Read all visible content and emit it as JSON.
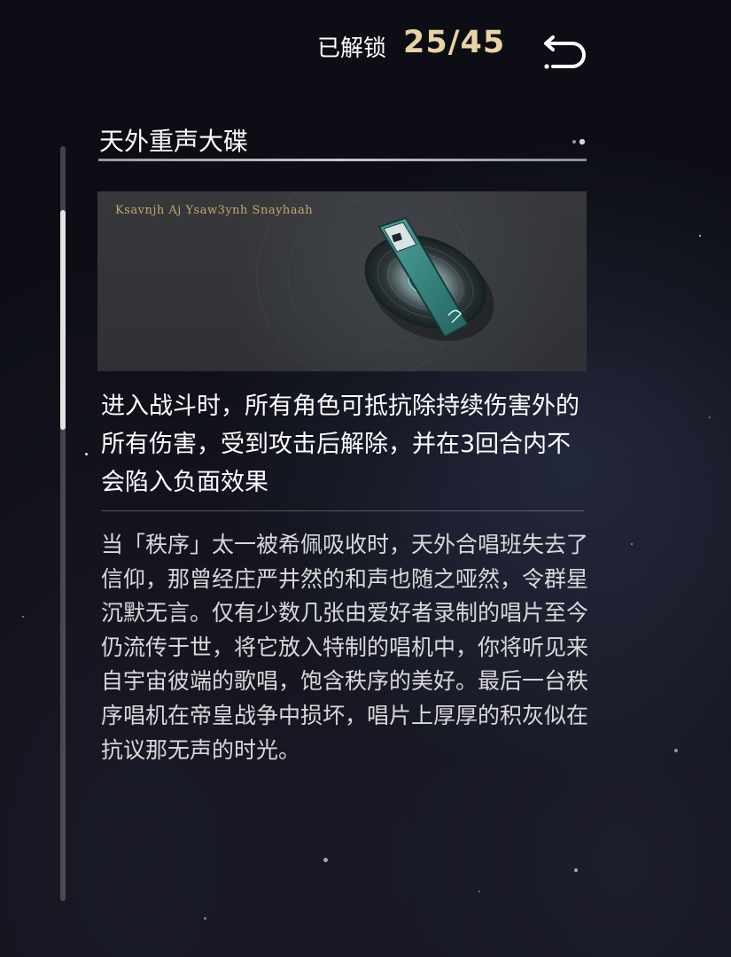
{
  "header": {
    "unlock_label": "已解锁",
    "unlock_count": "25/45",
    "back_icon": "return-arrow-icon"
  },
  "item": {
    "title": "天外重声大碟",
    "banner_caption": "Ksavnjh Aj Ysaw3ynh Snayhaah",
    "banner_icon": "vinyl-record-icon",
    "effect": "进入战斗时，所有角色可抵抗除持续伤害外的所有伤害，受到攻击后解除，并在3回合内不会陷入负面效果",
    "lore": "当「秩序」太一被希佩吸收时，天外合唱班失去了信仰，那曾经庄严井然的和声也随之哑然，令群星沉默无言。仅有少数几张由爱好者录制的唱片至今仍流传于世，将它放入特制的唱机中，你将听见来自宇宙彼端的歌唱，饱含秩序的美好。最后一台秩序唱机在帝皇战争中损坏，唱片上厚厚的积灰似在抗议那无声的时光。"
  },
  "colors": {
    "accent_gold": "#e8d3a4",
    "text_primary": "#ffffff",
    "text_secondary": "#d9d9d9",
    "banner_bg": "#333539"
  }
}
